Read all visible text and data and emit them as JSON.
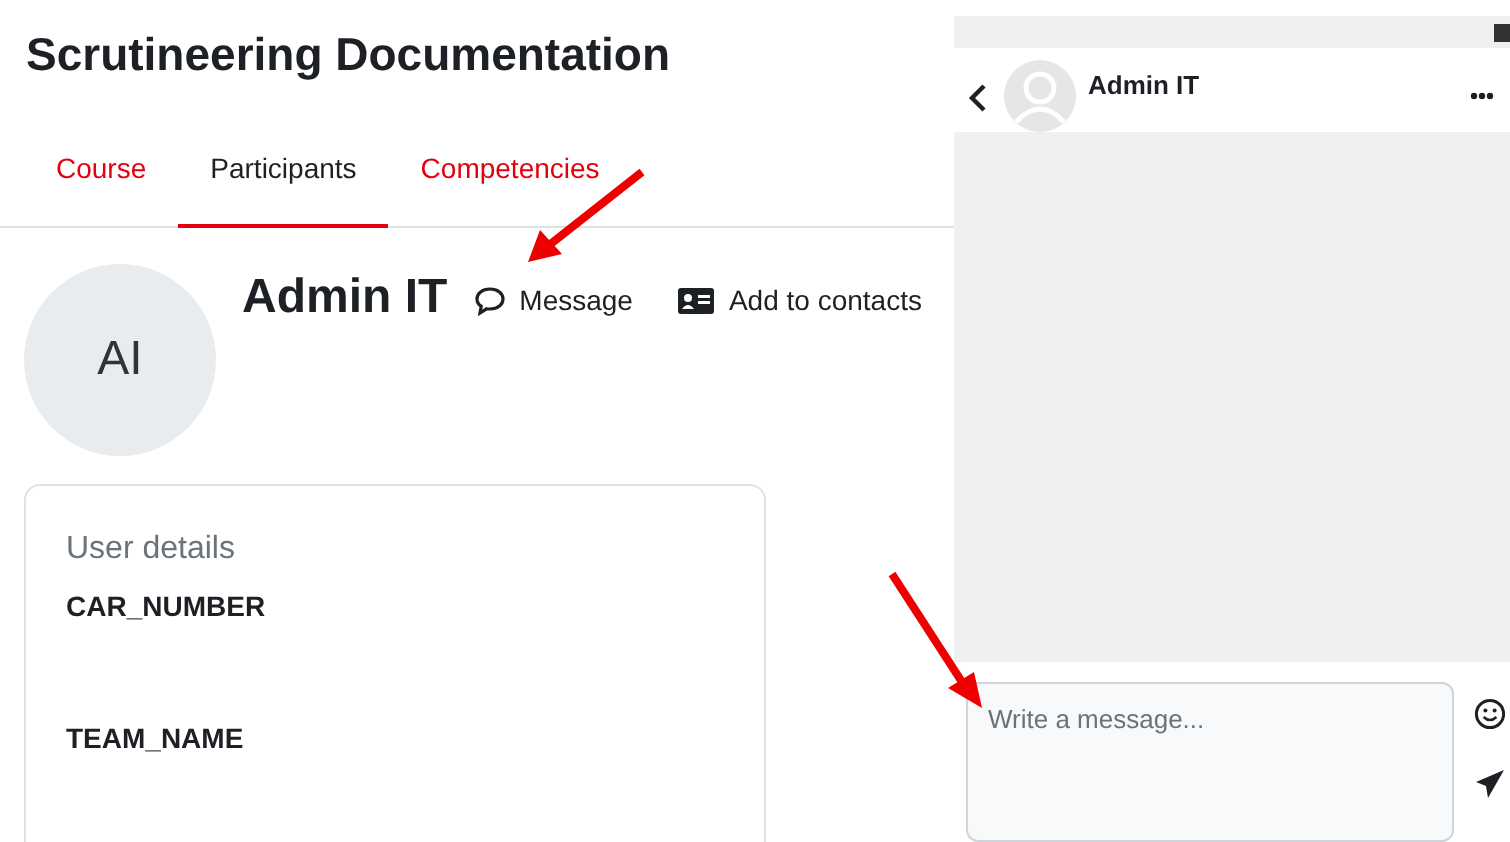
{
  "page": {
    "title": "Scrutineering Documentation"
  },
  "tabs": [
    {
      "label": "Course",
      "selected": false
    },
    {
      "label": "Participants",
      "selected": true
    },
    {
      "label": "Competencies",
      "selected": false
    }
  ],
  "profile": {
    "initials": "AI",
    "name": "Admin IT",
    "actions": [
      {
        "kind": "message",
        "label": "Message"
      },
      {
        "kind": "contact",
        "label": "Add to contacts"
      }
    ]
  },
  "user_details": {
    "heading": "User details",
    "fields": [
      {
        "label": "CAR_NUMBER"
      },
      {
        "label": "TEAM_NAME"
      }
    ]
  },
  "chat": {
    "name": "Admin IT",
    "composer": {
      "placeholder": "Write a message..."
    }
  }
}
